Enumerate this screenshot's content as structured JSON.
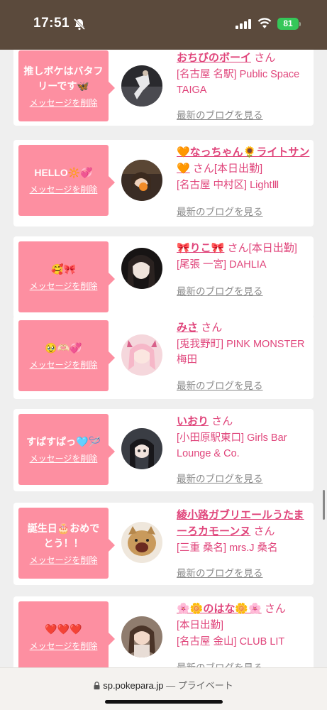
{
  "status": {
    "time": "17:51",
    "battery": "81"
  },
  "url_bar": {
    "domain": "sp.pokepara.jp",
    "separator": "—",
    "mode": "プライベート"
  },
  "cards": [
    {
      "message": "推しボケはバタフリーです🦋",
      "delete": "メッセージを削除",
      "name": "おちびのボーイ",
      "san": "さん",
      "shop": "[名古屋 名駅] Public Space TAIGA",
      "blog": "最新のブログを見る"
    },
    {
      "message": "HELLO🔆💞",
      "delete": "メッセージを削除",
      "name": "🧡なっちゃん🌻ライトサン🧡",
      "san": "さん[本日出勤]",
      "shop": "[名古屋 中村区] LightⅢ",
      "blog": "最新のブログを見る"
    },
    {
      "message": "🥰🎀",
      "delete": "メッセージを削除",
      "name": "🎀りこ🎀",
      "san": "さん[本日出勤]",
      "shop": "[尾張 一宮] DAHLIA",
      "blog": "最新のブログを見る"
    },
    {
      "message": "🥹🫶🏻💞",
      "delete": "メッセージを削除",
      "name": "みさ",
      "san": "さん",
      "shop": "[兎我野町] PINK MONSTER梅田",
      "blog": "最新のブログを見る"
    },
    {
      "message": "すぱすぱっ🩵🪡",
      "delete": "メッセージを削除",
      "name": "いおり",
      "san": "さん",
      "shop": "[小田原駅東口] Girls Bar Lounge & Co.",
      "blog": "最新のブログを見る"
    },
    {
      "message": "誕生日🎂おめでとう！！",
      "delete": "メッセージを削除",
      "name": "綾小路ガブリエールうたまーろカモーンヌ",
      "san": "さん",
      "shop": "[三重 桑名] mrs.J 桑名",
      "blog": "最新のブログを見る"
    },
    {
      "message": "❤️❤️❤️",
      "delete": "メッセージを削除",
      "name": "🌸🌼のはな🌼🌸",
      "san": "さん",
      "status": "[本日出勤]",
      "shop": "[名古屋 金山] CLUB LIT",
      "blog": "最新のブログを見る"
    }
  ],
  "icons": [
    "bell-off-icon",
    "signal-icon",
    "wifi-icon",
    "battery-icon",
    "lock-icon"
  ]
}
